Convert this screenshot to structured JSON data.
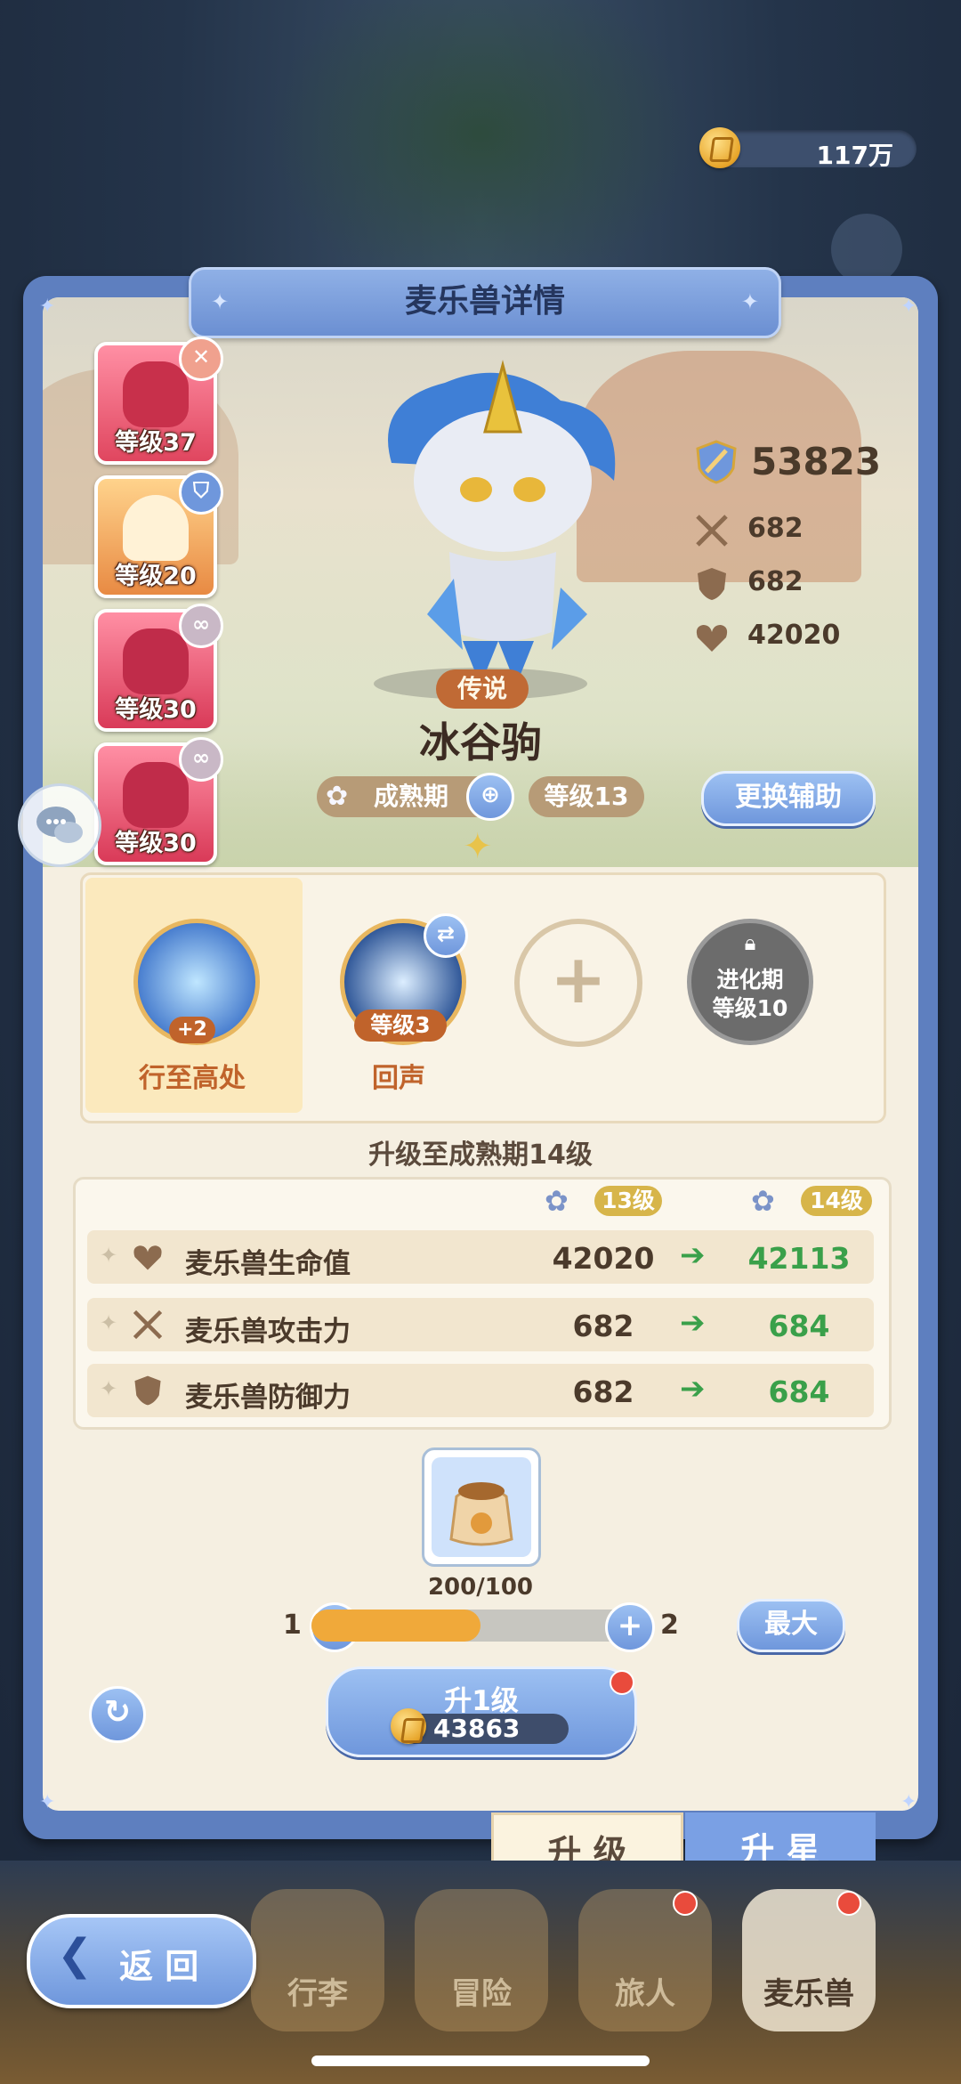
{
  "currency": {
    "amount": "117万"
  },
  "panel": {
    "title": "麦乐兽详情"
  },
  "teammates": [
    {
      "level": "等级37",
      "badge": "crossed-swords-icon"
    },
    {
      "level": "等级20",
      "badge": "shield-icon"
    },
    {
      "level": "等级30",
      "badge": "link-icon"
    },
    {
      "level": "等级30",
      "badge": "link-icon"
    }
  ],
  "pet": {
    "power": "53823",
    "attack": "682",
    "defense": "682",
    "hp": "42020",
    "rarity": "传说",
    "name": "冰谷驹",
    "stage": "成熟期",
    "level": "等级13",
    "swap_assist": "更换辅助"
  },
  "skills": [
    {
      "name": "行至高处",
      "badge": "+2"
    },
    {
      "name": "回声",
      "level": "等级3"
    },
    {
      "name": ""
    },
    {
      "locked_text_1": "进化期",
      "locked_text_2": "等级10"
    }
  ],
  "upgrade": {
    "title": "升级至成熟期14级",
    "current_level": "13级",
    "next_level": "14级",
    "rows": [
      {
        "name": "麦乐兽生命值",
        "current": "42020",
        "next": "42113",
        "icon": "heart-icon"
      },
      {
        "name": "麦乐兽攻击力",
        "current": "682",
        "next": "684",
        "icon": "swords-icon"
      },
      {
        "name": "麦乐兽防御力",
        "current": "682",
        "next": "684",
        "icon": "shield-icon"
      }
    ],
    "item_count": "200/100",
    "slider_min": "1",
    "slider_max": "2",
    "slider_fraction": 0.5,
    "max_label": "最大",
    "upgrade_button": "升1级",
    "cost": "43863"
  },
  "tabs": {
    "upgrade": "升 级",
    "star": "升 星"
  },
  "bottom_nav": {
    "back": "返 回",
    "items": [
      "行李",
      "冒险",
      "旅人",
      "麦乐兽"
    ]
  },
  "colors": {
    "panel_blue": "#5e7fbf",
    "accent_orange": "#c0632b",
    "increase_green": "#3aa04a"
  }
}
